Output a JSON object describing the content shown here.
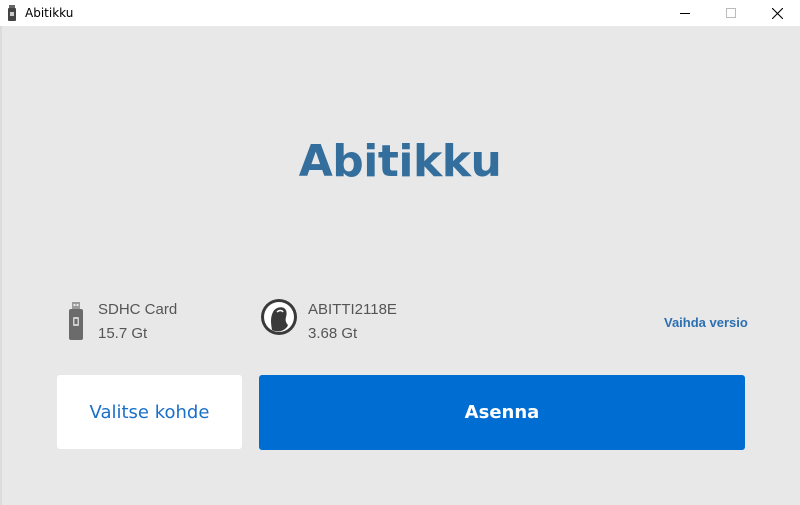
{
  "window": {
    "title": "Abitikku",
    "controls": {
      "minimize": "minimize-icon",
      "maximize": "maximize-icon",
      "close": "close-icon"
    }
  },
  "main": {
    "heading": "Abitikku"
  },
  "target": {
    "icon": "usb-drive-icon",
    "name": "SDHC Card",
    "size": "15.7 Gt"
  },
  "image": {
    "icon": "abitti-logo-icon",
    "name": "ABITTI2118E",
    "size": "3.68 Gt",
    "change_label": "Vaihda versio"
  },
  "actions": {
    "select_target_label": "Valitse kohde",
    "install_label": "Asenna"
  },
  "colors": {
    "heading": "#336e9c",
    "accent": "#006dd3",
    "link": "#2c6fb0",
    "background": "#e8e8e8"
  }
}
